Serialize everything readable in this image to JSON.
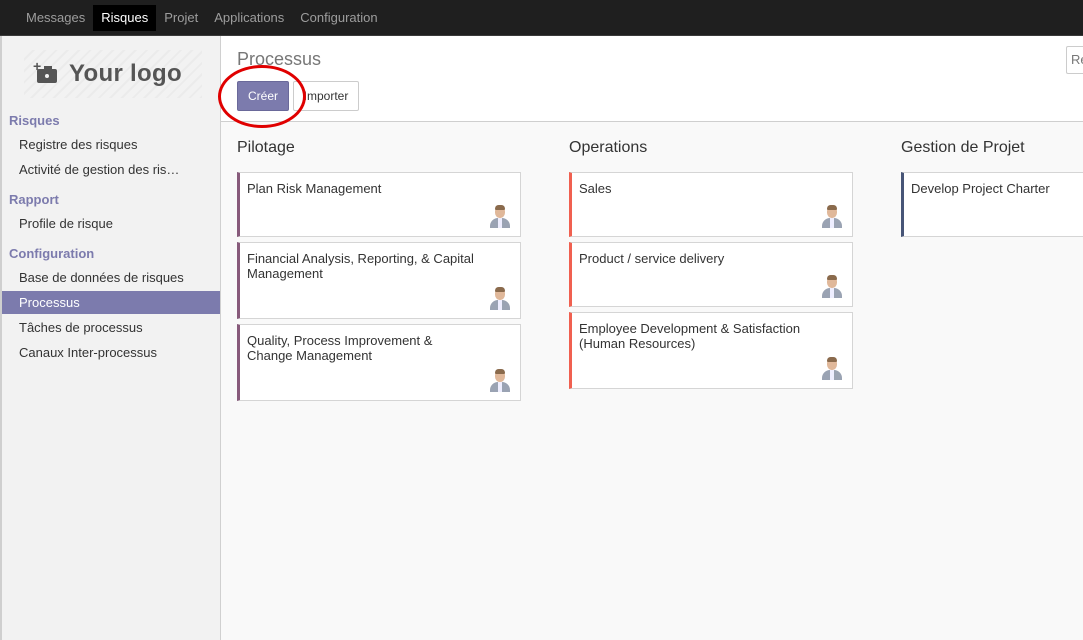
{
  "topbar": {
    "menu": [
      {
        "label": "Messages",
        "active": false
      },
      {
        "label": "Risques",
        "active": true
      },
      {
        "label": "Projet",
        "active": false
      },
      {
        "label": "Applications",
        "active": false
      },
      {
        "label": "Configuration",
        "active": false
      }
    ]
  },
  "sidebar": {
    "logo_text": "Your logo",
    "sections": [
      {
        "title": "Risques",
        "items": [
          "Registre des risques",
          "Activité de gestion des ris…"
        ]
      },
      {
        "title": "Rapport",
        "items": [
          "Profile de risque"
        ]
      },
      {
        "title": "Configuration",
        "items": [
          "Base de données de risques",
          "Processus",
          "Tâches de processus",
          "Canaux Inter-processus"
        ]
      }
    ],
    "active_item": "Processus"
  },
  "main": {
    "title": "Processus",
    "create_label": "Créer",
    "import_label": "Importer",
    "search_placeholder": "Re"
  },
  "kanban": {
    "columns": [
      {
        "title": "Pilotage",
        "accent": "#875a7b",
        "cards": [
          "Plan Risk Management",
          "Financial Analysis, Reporting, & Capital Management",
          "Quality, Process Improvement & Change Management"
        ]
      },
      {
        "title": "Operations",
        "accent": "#f06050",
        "cards": [
          "Sales",
          "Product / service delivery",
          "Employee Development & Satisfaction (Human Resources)"
        ]
      },
      {
        "title": "Gestion de Projet",
        "accent": "#475577",
        "cards": [
          "Develop Project Charter"
        ]
      }
    ]
  },
  "colors": {
    "primary": "#7c7bad",
    "topbar": "#1f1f1f",
    "annotation": "#e00000"
  }
}
